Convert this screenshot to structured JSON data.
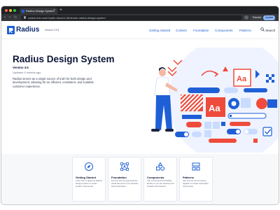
{
  "browser": {
    "tab_title": "Radius Design System",
    "url": "radius.rbix.com/?path=/docs/1-Welcome-radius-design-system",
    "update_label": "Update",
    "profile_label": "Paused"
  },
  "header": {
    "logo_text": "Radius",
    "version_select": "Version 3.5",
    "nav": [
      "Getting Started",
      "Content",
      "Foundation",
      "Components",
      "Patterns"
    ],
    "search_label": "Search"
  },
  "hero": {
    "title": "Radius Design System",
    "version": "Version 3.5",
    "updated": "Updated 3 months ago",
    "description": "Radius serves as a single source of truth for both design and development, allowing for an efficient, consistent, and scalable customer experience.",
    "illustration_tile_letter": "Aa"
  },
  "cards": [
    {
      "title": "Getting Started",
      "icon": "compass-icon",
      "description": "Learn how to apply the Radius Design System to create product experiences."
    },
    {
      "title": "Foundation",
      "icon": "frame-icon",
      "description": "Find out how we approach the visual elements of our interface and presentation."
    },
    {
      "title": "Components",
      "icon": "shapes-icon",
      "description": "Use components as building blocks so you can develop new products and features."
    },
    {
      "title": "Patterns",
      "icon": "layers-icon",
      "description": "See how we put the pieces together to create meaningful experiences."
    }
  ],
  "colors": {
    "brand_blue": "#1f5fd6",
    "accent_red": "#ef4b3c",
    "navy_text": "#0b1437",
    "light_blue": "#c9dbff"
  }
}
